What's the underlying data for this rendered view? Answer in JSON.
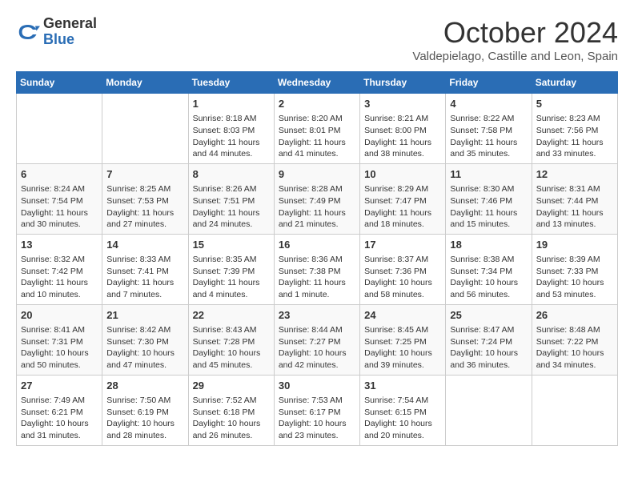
{
  "header": {
    "logo": {
      "general": "General",
      "blue": "Blue"
    },
    "title": "October 2024",
    "location": "Valdepielago, Castille and Leon, Spain"
  },
  "weekdays": [
    "Sunday",
    "Monday",
    "Tuesday",
    "Wednesday",
    "Thursday",
    "Friday",
    "Saturday"
  ],
  "weeks": [
    [
      {
        "day": "",
        "sunrise": "",
        "sunset": "",
        "daylight": ""
      },
      {
        "day": "",
        "sunrise": "",
        "sunset": "",
        "daylight": ""
      },
      {
        "day": "1",
        "sunrise": "Sunrise: 8:18 AM",
        "sunset": "Sunset: 8:03 PM",
        "daylight": "Daylight: 11 hours and 44 minutes."
      },
      {
        "day": "2",
        "sunrise": "Sunrise: 8:20 AM",
        "sunset": "Sunset: 8:01 PM",
        "daylight": "Daylight: 11 hours and 41 minutes."
      },
      {
        "day": "3",
        "sunrise": "Sunrise: 8:21 AM",
        "sunset": "Sunset: 8:00 PM",
        "daylight": "Daylight: 11 hours and 38 minutes."
      },
      {
        "day": "4",
        "sunrise": "Sunrise: 8:22 AM",
        "sunset": "Sunset: 7:58 PM",
        "daylight": "Daylight: 11 hours and 35 minutes."
      },
      {
        "day": "5",
        "sunrise": "Sunrise: 8:23 AM",
        "sunset": "Sunset: 7:56 PM",
        "daylight": "Daylight: 11 hours and 33 minutes."
      }
    ],
    [
      {
        "day": "6",
        "sunrise": "Sunrise: 8:24 AM",
        "sunset": "Sunset: 7:54 PM",
        "daylight": "Daylight: 11 hours and 30 minutes."
      },
      {
        "day": "7",
        "sunrise": "Sunrise: 8:25 AM",
        "sunset": "Sunset: 7:53 PM",
        "daylight": "Daylight: 11 hours and 27 minutes."
      },
      {
        "day": "8",
        "sunrise": "Sunrise: 8:26 AM",
        "sunset": "Sunset: 7:51 PM",
        "daylight": "Daylight: 11 hours and 24 minutes."
      },
      {
        "day": "9",
        "sunrise": "Sunrise: 8:28 AM",
        "sunset": "Sunset: 7:49 PM",
        "daylight": "Daylight: 11 hours and 21 minutes."
      },
      {
        "day": "10",
        "sunrise": "Sunrise: 8:29 AM",
        "sunset": "Sunset: 7:47 PM",
        "daylight": "Daylight: 11 hours and 18 minutes."
      },
      {
        "day": "11",
        "sunrise": "Sunrise: 8:30 AM",
        "sunset": "Sunset: 7:46 PM",
        "daylight": "Daylight: 11 hours and 15 minutes."
      },
      {
        "day": "12",
        "sunrise": "Sunrise: 8:31 AM",
        "sunset": "Sunset: 7:44 PM",
        "daylight": "Daylight: 11 hours and 13 minutes."
      }
    ],
    [
      {
        "day": "13",
        "sunrise": "Sunrise: 8:32 AM",
        "sunset": "Sunset: 7:42 PM",
        "daylight": "Daylight: 11 hours and 10 minutes."
      },
      {
        "day": "14",
        "sunrise": "Sunrise: 8:33 AM",
        "sunset": "Sunset: 7:41 PM",
        "daylight": "Daylight: 11 hours and 7 minutes."
      },
      {
        "day": "15",
        "sunrise": "Sunrise: 8:35 AM",
        "sunset": "Sunset: 7:39 PM",
        "daylight": "Daylight: 11 hours and 4 minutes."
      },
      {
        "day": "16",
        "sunrise": "Sunrise: 8:36 AM",
        "sunset": "Sunset: 7:38 PM",
        "daylight": "Daylight: 11 hours and 1 minute."
      },
      {
        "day": "17",
        "sunrise": "Sunrise: 8:37 AM",
        "sunset": "Sunset: 7:36 PM",
        "daylight": "Daylight: 10 hours and 58 minutes."
      },
      {
        "day": "18",
        "sunrise": "Sunrise: 8:38 AM",
        "sunset": "Sunset: 7:34 PM",
        "daylight": "Daylight: 10 hours and 56 minutes."
      },
      {
        "day": "19",
        "sunrise": "Sunrise: 8:39 AM",
        "sunset": "Sunset: 7:33 PM",
        "daylight": "Daylight: 10 hours and 53 minutes."
      }
    ],
    [
      {
        "day": "20",
        "sunrise": "Sunrise: 8:41 AM",
        "sunset": "Sunset: 7:31 PM",
        "daylight": "Daylight: 10 hours and 50 minutes."
      },
      {
        "day": "21",
        "sunrise": "Sunrise: 8:42 AM",
        "sunset": "Sunset: 7:30 PM",
        "daylight": "Daylight: 10 hours and 47 minutes."
      },
      {
        "day": "22",
        "sunrise": "Sunrise: 8:43 AM",
        "sunset": "Sunset: 7:28 PM",
        "daylight": "Daylight: 10 hours and 45 minutes."
      },
      {
        "day": "23",
        "sunrise": "Sunrise: 8:44 AM",
        "sunset": "Sunset: 7:27 PM",
        "daylight": "Daylight: 10 hours and 42 minutes."
      },
      {
        "day": "24",
        "sunrise": "Sunrise: 8:45 AM",
        "sunset": "Sunset: 7:25 PM",
        "daylight": "Daylight: 10 hours and 39 minutes."
      },
      {
        "day": "25",
        "sunrise": "Sunrise: 8:47 AM",
        "sunset": "Sunset: 7:24 PM",
        "daylight": "Daylight: 10 hours and 36 minutes."
      },
      {
        "day": "26",
        "sunrise": "Sunrise: 8:48 AM",
        "sunset": "Sunset: 7:22 PM",
        "daylight": "Daylight: 10 hours and 34 minutes."
      }
    ],
    [
      {
        "day": "27",
        "sunrise": "Sunrise: 7:49 AM",
        "sunset": "Sunset: 6:21 PM",
        "daylight": "Daylight: 10 hours and 31 minutes."
      },
      {
        "day": "28",
        "sunrise": "Sunrise: 7:50 AM",
        "sunset": "Sunset: 6:19 PM",
        "daylight": "Daylight: 10 hours and 28 minutes."
      },
      {
        "day": "29",
        "sunrise": "Sunrise: 7:52 AM",
        "sunset": "Sunset: 6:18 PM",
        "daylight": "Daylight: 10 hours and 26 minutes."
      },
      {
        "day": "30",
        "sunrise": "Sunrise: 7:53 AM",
        "sunset": "Sunset: 6:17 PM",
        "daylight": "Daylight: 10 hours and 23 minutes."
      },
      {
        "day": "31",
        "sunrise": "Sunrise: 7:54 AM",
        "sunset": "Sunset: 6:15 PM",
        "daylight": "Daylight: 10 hours and 20 minutes."
      },
      {
        "day": "",
        "sunrise": "",
        "sunset": "",
        "daylight": ""
      },
      {
        "day": "",
        "sunrise": "",
        "sunset": "",
        "daylight": ""
      }
    ]
  ]
}
